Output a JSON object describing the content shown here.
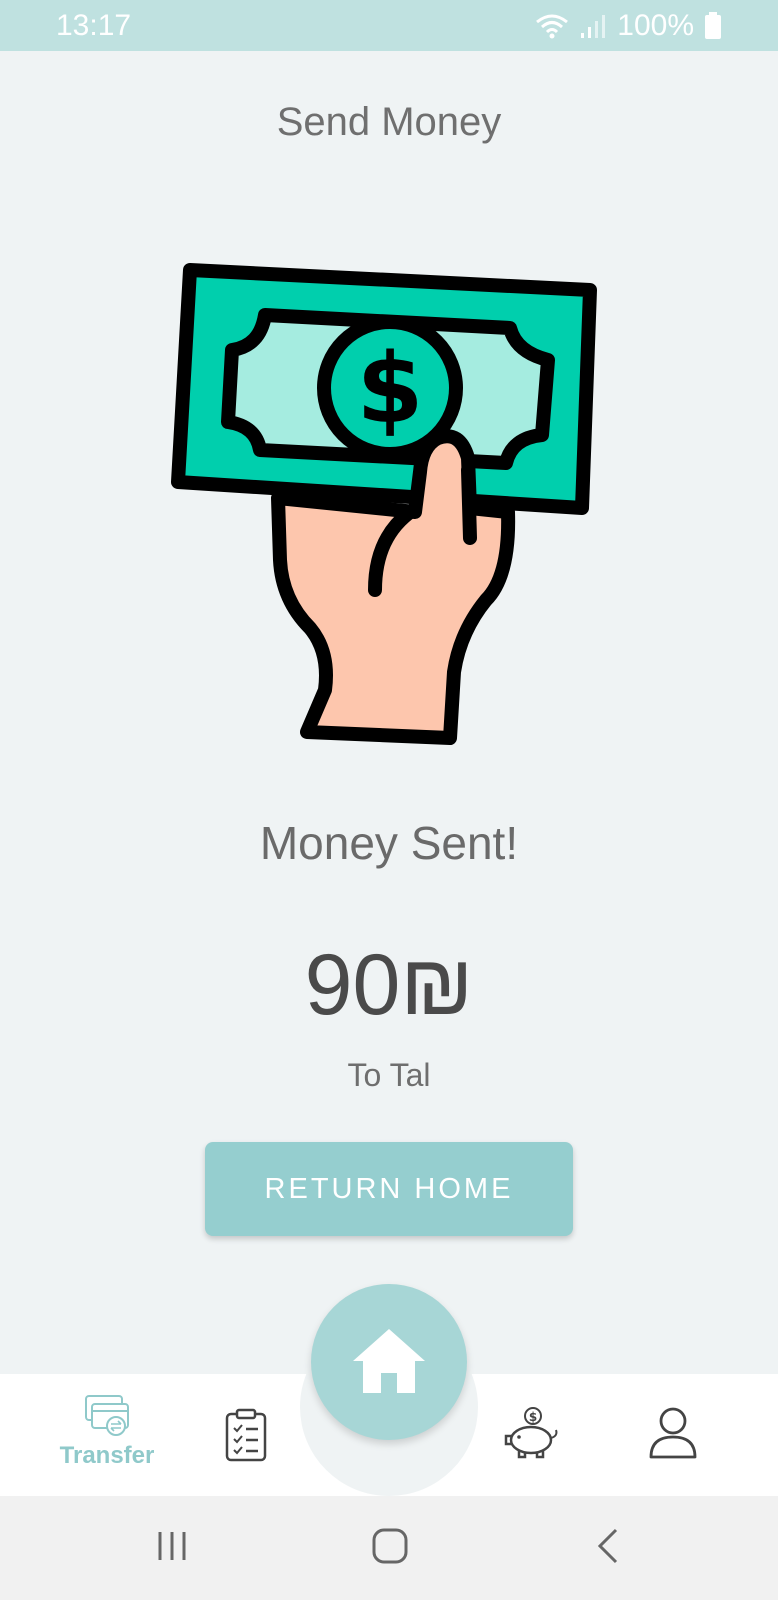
{
  "status_bar": {
    "time": "13:17",
    "battery": "100%",
    "icons": [
      "wifi-icon",
      "signal-icon",
      "battery-icon"
    ]
  },
  "header": {
    "title": "Send Money"
  },
  "illustration": {
    "icon": "hand-holding-money-icon"
  },
  "result": {
    "title": "Money Sent!",
    "amount": "90₪",
    "recipient": "To Tal"
  },
  "actions": {
    "return_home": "RETURN HOME"
  },
  "bottom_nav": {
    "items": [
      {
        "label": "Transfer",
        "icon": "transfer-card-icon",
        "active": true
      },
      {
        "label": "",
        "icon": "clipboard-list-icon"
      },
      {
        "label": "",
        "icon": "home-icon"
      },
      {
        "label": "",
        "icon": "piggy-bank-icon"
      },
      {
        "label": "",
        "icon": "user-icon"
      }
    ]
  },
  "system_nav": {
    "buttons": [
      "recent-apps-icon",
      "home-circle-icon",
      "back-icon"
    ]
  },
  "colors": {
    "accent": "#95cecf",
    "status_bar": "#bfe1e0",
    "bill_green": "#00cfad",
    "skin": "#fdc6ad"
  }
}
